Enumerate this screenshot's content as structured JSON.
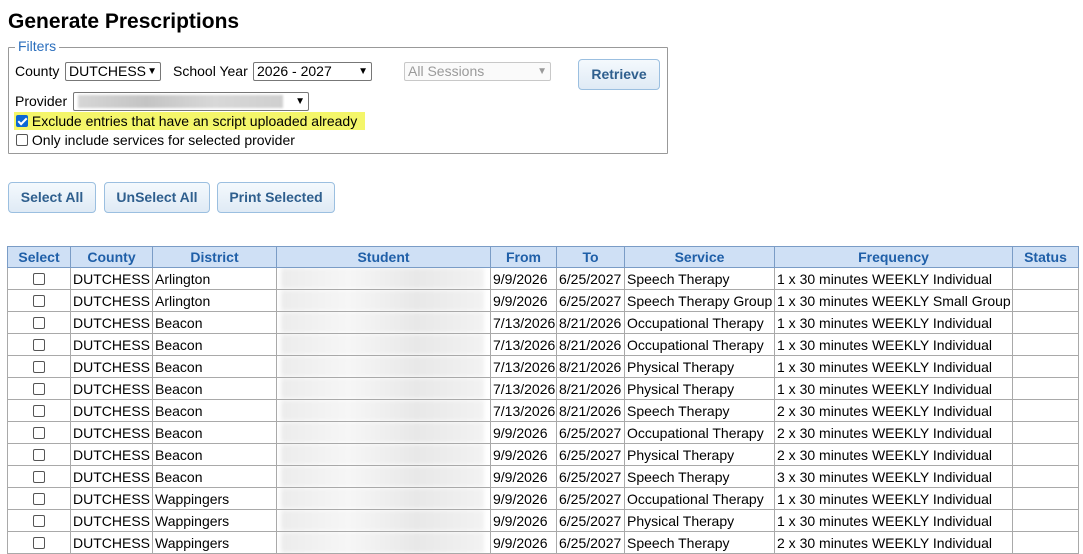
{
  "page": {
    "title": "Generate Prescriptions"
  },
  "filters": {
    "legend": "Filters",
    "county_label": "County",
    "county_value": "DUTCHESS",
    "school_year_label": "School Year",
    "school_year_value": "2026 - 2027",
    "sessions_value": "All Sessions",
    "provider_label": "Provider",
    "provider_value": "",
    "exclude_label": "Exclude entries that have an script uploaded already",
    "exclude_checked": true,
    "only_provider_label": "Only include services for selected provider",
    "only_provider_checked": false,
    "retrieve_label": "Retrieve"
  },
  "actions": {
    "select_all": "Select All",
    "unselect_all": "UnSelect All",
    "print_selected": "Print Selected"
  },
  "table": {
    "headers": [
      "Select",
      "County",
      "District",
      "Student",
      "From",
      "To",
      "Service",
      "Frequency",
      "Status"
    ],
    "rows": [
      {
        "county": "DUTCHESS",
        "district": "Arlington",
        "from": "9/9/2026",
        "to": "6/25/2027",
        "service": "Speech Therapy",
        "frequency": "1 x 30 minutes WEEKLY Individual",
        "status": ""
      },
      {
        "county": "DUTCHESS",
        "district": "Arlington",
        "from": "9/9/2026",
        "to": "6/25/2027",
        "service": "Speech Therapy Group",
        "frequency": "1 x 30 minutes WEEKLY Small Group",
        "status": ""
      },
      {
        "county": "DUTCHESS",
        "district": "Beacon",
        "from": "7/13/2026",
        "to": "8/21/2026",
        "service": "Occupational Therapy",
        "frequency": "1 x 30 minutes WEEKLY Individual",
        "status": ""
      },
      {
        "county": "DUTCHESS",
        "district": "Beacon",
        "from": "7/13/2026",
        "to": "8/21/2026",
        "service": "Occupational Therapy",
        "frequency": "1 x 30 minutes WEEKLY Individual",
        "status": ""
      },
      {
        "county": "DUTCHESS",
        "district": "Beacon",
        "from": "7/13/2026",
        "to": "8/21/2026",
        "service": "Physical Therapy",
        "frequency": "1 x 30 minutes WEEKLY Individual",
        "status": ""
      },
      {
        "county": "DUTCHESS",
        "district": "Beacon",
        "from": "7/13/2026",
        "to": "8/21/2026",
        "service": "Physical Therapy",
        "frequency": "1 x 30 minutes WEEKLY Individual",
        "status": ""
      },
      {
        "county": "DUTCHESS",
        "district": "Beacon",
        "from": "7/13/2026",
        "to": "8/21/2026",
        "service": "Speech Therapy",
        "frequency": "2 x 30 minutes WEEKLY Individual",
        "status": ""
      },
      {
        "county": "DUTCHESS",
        "district": "Beacon",
        "from": "9/9/2026",
        "to": "6/25/2027",
        "service": "Occupational Therapy",
        "frequency": "2 x 30 minutes WEEKLY Individual",
        "status": ""
      },
      {
        "county": "DUTCHESS",
        "district": "Beacon",
        "from": "9/9/2026",
        "to": "6/25/2027",
        "service": "Physical Therapy",
        "frequency": "2 x 30 minutes WEEKLY Individual",
        "status": ""
      },
      {
        "county": "DUTCHESS",
        "district": "Beacon",
        "from": "9/9/2026",
        "to": "6/25/2027",
        "service": "Speech Therapy",
        "frequency": "3 x 30 minutes WEEKLY Individual",
        "status": ""
      },
      {
        "county": "DUTCHESS",
        "district": "Wappingers",
        "from": "9/9/2026",
        "to": "6/25/2027",
        "service": "Occupational Therapy",
        "frequency": "1 x 30 minutes WEEKLY Individual",
        "status": ""
      },
      {
        "county": "DUTCHESS",
        "district": "Wappingers",
        "from": "9/9/2026",
        "to": "6/25/2027",
        "service": "Physical Therapy",
        "frequency": "1 x 30 minutes WEEKLY Individual",
        "status": ""
      },
      {
        "county": "DUTCHESS",
        "district": "Wappingers",
        "from": "9/9/2026",
        "to": "6/25/2027",
        "service": "Speech Therapy",
        "frequency": "2 x 30 minutes WEEKLY Individual",
        "status": ""
      }
    ]
  },
  "icons": {
    "dropdown": "chevron-down-icon",
    "checkbox": "checkbox-icon"
  },
  "colors": {
    "header_bg": "#cfe0f5",
    "header_text": "#1f5fa8",
    "highlight": "#f4f66a",
    "button_text": "#2f5f8e"
  }
}
